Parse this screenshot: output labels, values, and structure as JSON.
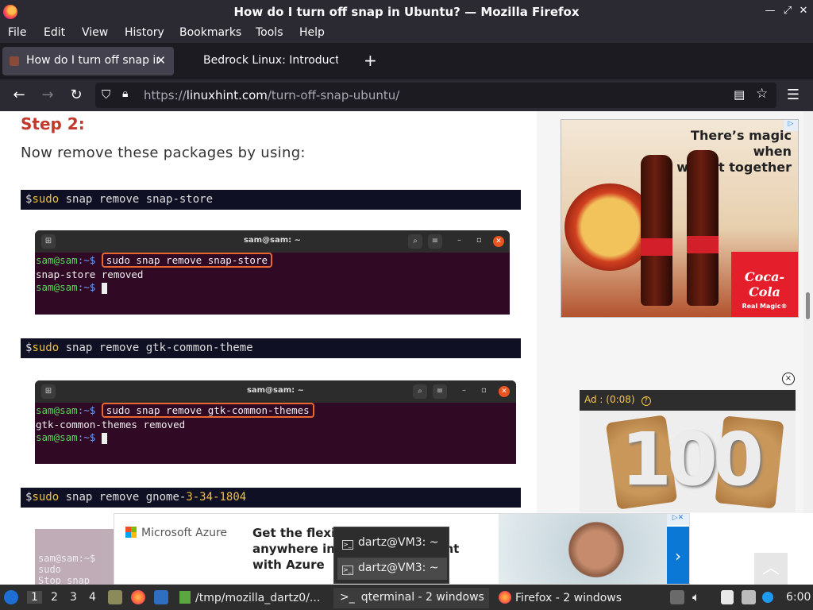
{
  "window": {
    "title": "How do I turn off snap in Ubuntu? — Mozilla Firefox"
  },
  "menu": [
    "File",
    "Edit",
    "View",
    "History",
    "Bookmarks",
    "Tools",
    "Help"
  ],
  "tabs": [
    {
      "label": "How do I turn off snap in Ubuntu?",
      "active": true
    },
    {
      "label": "Bedrock Linux: Introduction",
      "active": false
    }
  ],
  "nav": {
    "url_prefix": "https://",
    "url_domain": "linuxhint.com",
    "url_path": "/turn-off-snap-ubuntu/"
  },
  "article": {
    "step_heading": "Step 2:",
    "intro": "Now remove these packages by using:",
    "commands": [
      {
        "prompt": "$",
        "keyword": "sudo",
        "rest": " snap remove snap-store"
      },
      {
        "prompt": "$",
        "keyword": "sudo",
        "rest": " snap remove gtk-common-theme"
      },
      {
        "prompt": "$",
        "keyword": "sudo",
        "rest": " snap remove gnome-",
        "num": "3-34-1804"
      }
    ],
    "terminals": [
      {
        "title": "sam@sam: ~",
        "prompt_user": "sam@sam",
        "prompt_path": ":~$ ",
        "command": "sudo snap remove snap-store",
        "output": "snap-store removed"
      },
      {
        "title": "sam@sam: ~",
        "prompt_user": "sam@sam",
        "prompt_path": ":~$ ",
        "command": "sudo snap remove gtk-common-themes",
        "output": "gtk-common-themes removed"
      }
    ],
    "faded_terminal_lines": [
      "sam@sam:~$ sudo",
      "Stop snap \"gno"
    ]
  },
  "ads": {
    "side_top": {
      "tagline_1": "There’s magic when",
      "tagline_2": "we eat together",
      "brand": "Coca-Cola",
      "brand_sub": "Real Magic®"
    },
    "side_video": {
      "timer": "Ad : (0:08)",
      "help": "?",
      "number": "100"
    },
    "close_glyph": "×",
    "banner": {
      "brand": "Microsoft Azure",
      "line_1": "Get the flexibility you need",
      "line_2": "anywhere in your environment",
      "line_3": "with Azure",
      "arrow": "›"
    }
  },
  "popup": {
    "items": [
      "dartz@VM3: ~",
      "dartz@VM3: ~"
    ]
  },
  "taskbar": {
    "workspaces": [
      "1",
      "2",
      "3",
      "4"
    ],
    "tasks": [
      {
        "label": "/tmp/mozilla_dartz0/..."
      },
      {
        "label": "qterminal - 2 windows"
      },
      {
        "label": "Firefox - 2 windows"
      }
    ],
    "clock": "6:00"
  },
  "colors": {
    "accent_heading": "#c0392b",
    "code_keyword": "#f0c040",
    "terminal_bg": "#300a24",
    "highlight_box": "#e9672f"
  }
}
